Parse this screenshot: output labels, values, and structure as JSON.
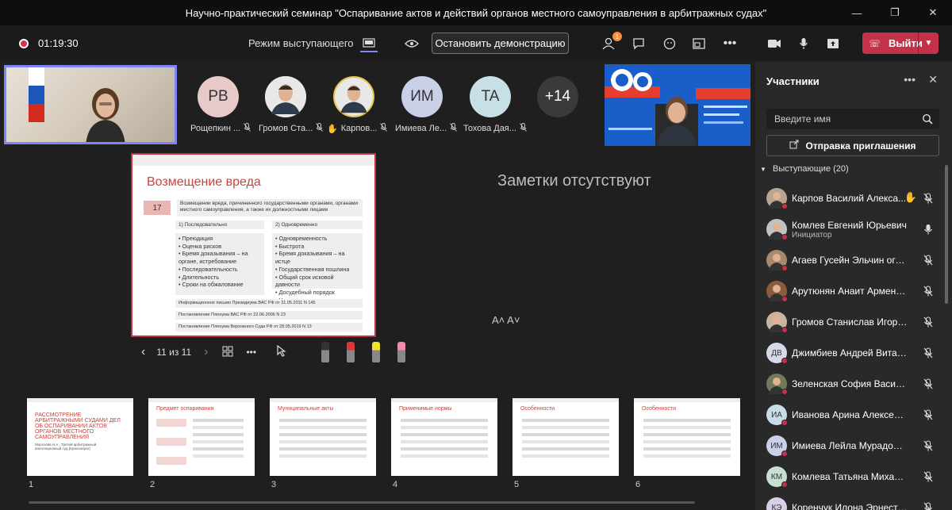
{
  "window": {
    "title": "Научно-практический семинар \"Оспаривание актов и действий органов местного самоуправления в арбитражных судах\""
  },
  "toolbar": {
    "timer": "01:19:30",
    "presenter_mode": "Режим выступающего",
    "stop_sharing": "Остановить демонстрацию",
    "participants_badge": "1",
    "more": "•••",
    "leave": "Выйти"
  },
  "participant_tiles": [
    {
      "initials": "PB",
      "name": "Рощепкин ...",
      "color": "#e8c9c9"
    },
    {
      "initials": "",
      "name": "Громов Ста...",
      "color": "#c8c8c8"
    },
    {
      "initials": "",
      "name": "Карпов...",
      "color": "#c8c8c8"
    },
    {
      "initials": "ИМ",
      "name": "Имиева Ле...",
      "color": "#c9d0e8"
    },
    {
      "initials": "TA",
      "name": "Тохова Дая...",
      "color": "#c7dfe6"
    },
    {
      "initials": "+14",
      "name": "",
      "color": "#3a3a3a"
    }
  ],
  "slide": {
    "title": "Возмещение вреда",
    "number": "17",
    "description": "Возмещении вреда, причиненного государственными органами, органами местного самоуправления, а также их должностными лицами",
    "col1_header": "1) Последовательно",
    "col2_header": "2) Одновременно",
    "col1_items": [
      "Преюдиция",
      "Оценка рисков",
      "Бремя доказывания – на органе, истребование",
      "Последовательность",
      "Длительность",
      "Сроки на обжалование"
    ],
    "col2_items": [
      "Одновременность",
      "Быстрота",
      "Бремя доказывания – на истце",
      "Государственная пошлина",
      "Общий срок исковой давности",
      "Досудебный порядок",
      "Упрощенное производство"
    ],
    "laws": [
      "Информационное письмо Президиума ВАС РФ от 31.05.2011 N 145",
      "Постановление Пленума ВАС РФ от 22.06.2006 N 23",
      "Постановление Пленума Верховного Суда РФ от 28.05.2019 N 13"
    ]
  },
  "notes": {
    "empty": "Заметки отсутствуют",
    "font_controls": "A˄  A˅"
  },
  "slidenav": {
    "counter": "11 из 11",
    "more": "•••"
  },
  "thumbnails": [
    {
      "num": "1",
      "title": "РАССМОТРЕНИЕ АРБИТРАЖНЫМИ СУДАМИ ДЕЛ ОБ ОСПАРИВАНИИ АКТОВ ОРГАНОВ МЕСТНОГО САМОУПРАВЛЕНИЯ",
      "sub": "Морозова Н.А., Третий арбитражный апелляционный суд (Красноярск)"
    },
    {
      "num": "2",
      "title": "Предмет оспаривания",
      "sub": ""
    },
    {
      "num": "3",
      "title": "Муниципальные акты",
      "sub": ""
    },
    {
      "num": "4",
      "title": "Применимые нормы",
      "sub": ""
    },
    {
      "num": "5",
      "title": "Особенности",
      "sub": ""
    },
    {
      "num": "6",
      "title": "Особенности",
      "sub": ""
    }
  ],
  "panel": {
    "title": "Участники",
    "more": "•••",
    "search_placeholder": "Введите имя",
    "invite": "Отправка приглашения",
    "section": "Выступающие (20)"
  },
  "participants": [
    {
      "name": "Карпов Василий Алекса...",
      "sub": "",
      "initials": "",
      "color": "#b9a58f",
      "hand": true,
      "mic": "off"
    },
    {
      "name": "Комлев Евгений Юрьевич",
      "sub": "Инициатор",
      "initials": "",
      "color": "#c2c2c2",
      "hand": false,
      "mic": "on"
    },
    {
      "name": "Агаев Гусейн Эльчин оглы Э...",
      "sub": "",
      "initials": "",
      "color": "#a78a6e",
      "hand": false,
      "mic": "off"
    },
    {
      "name": "Арутюнян Анаит Армен​овна",
      "sub": "",
      "initials": "",
      "color": "#8c5a3c",
      "hand": false,
      "mic": "off"
    },
    {
      "name": "Громов Станислав Игоревич",
      "sub": "",
      "initials": "",
      "color": "#c9b59f",
      "hand": false,
      "mic": "off"
    },
    {
      "name": "Джимбиев Андрей Витальев...",
      "sub": "",
      "initials": "ДВ",
      "color": "#d6d9e8",
      "hand": false,
      "mic": "off"
    },
    {
      "name": "Зеленская София Васильевна",
      "sub": "",
      "initials": "",
      "color": "#6f7a5a",
      "hand": false,
      "mic": "off"
    },
    {
      "name": "Иванова Арина Алексеевна",
      "sub": "",
      "initials": "ИА",
      "color": "#c9dde6",
      "hand": false,
      "mic": "off"
    },
    {
      "name": "Имиева Лейла Мурадовна",
      "sub": "",
      "initials": "ИМ",
      "color": "#c9d0e8",
      "hand": false,
      "mic": "off"
    },
    {
      "name": "Комлева Татьяна Михайловна",
      "sub": "",
      "initials": "КМ",
      "color": "#c8dfd4",
      "hand": false,
      "mic": "off"
    },
    {
      "name": "Коренчук Илона Эрнестовна",
      "sub": "",
      "initials": "КЭ",
      "color": "#d8cfe6",
      "hand": false,
      "mic": "off"
    }
  ]
}
